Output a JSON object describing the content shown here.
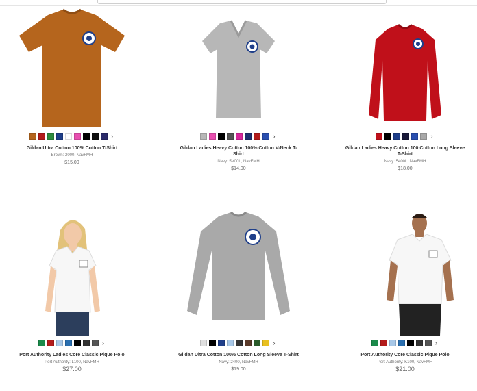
{
  "products": [
    {
      "title": "Gildan Ultra Cotton 100% Cotton T-Shirt",
      "sku": "Brown: 2000, NavFMH",
      "price": "$15.00",
      "image": "orange-tshirt",
      "colors": [
        "#b5651d",
        "#b31b1b",
        "#2e8b3e",
        "#1f3f8a",
        "#ffffff",
        "#e84fb0",
        "#000000",
        "#101010",
        "#2a2a6a"
      ]
    },
    {
      "title": "Gildan Ladies Heavy Cotton 100% Cotton V-Neck T-Shirt",
      "sku": "Navy: 5V00L, NavFMH",
      "price": "$14.00",
      "image": "grey-vneck",
      "colors": [
        "#b8b8b8",
        "#e84fb0",
        "#000000",
        "#555555",
        "#d8269c",
        "#1e2f6e",
        "#b31b1b",
        "#2a4fb0"
      ]
    },
    {
      "title": "Gildan Ladies Heavy Cotton 100 Cotton Long Sleeve T-Shirt",
      "sku": "Navy: 5400L, NavFMH",
      "price": "$18.00",
      "image": "red-longsleeve",
      "colors": [
        "#c0101a",
        "#000000",
        "#1f3f8a",
        "#1a1a3a",
        "#2a4fb0",
        "#a8a8a8"
      ]
    },
    {
      "title": "Port Authority Ladies Core Classic Pique Polo",
      "sku": "Port Authority: L100, NavFMH",
      "price": "$27.00",
      "image": "woman-white-polo",
      "colors": [
        "#1a8a4a",
        "#b31b1b",
        "#a8c8e8",
        "#2a6fb0",
        "#000000",
        "#333333",
        "#555555"
      ]
    },
    {
      "title": "Gildan Ultra Cotton 100% Cotton Long Sleeve T-Shirt",
      "sku": "Navy: 2400, NavFMH",
      "price": "$19.00",
      "image": "grey-longsleeve",
      "colors": [
        "#e0e0e0",
        "#000000",
        "#1f3f8a",
        "#a8c8e8",
        "#333333",
        "#5a3a2a",
        "#2a5a2a",
        "#e8c020"
      ]
    },
    {
      "title": "Port Authority Core Classic Pique Polo",
      "sku": "Port Authority: K100, NavFMH",
      "price": "$21.00",
      "image": "man-white-polo",
      "colors": [
        "#1a8a4a",
        "#b31b1b",
        "#a8c8e8",
        "#2a6fb0",
        "#000000",
        "#333333",
        "#555555"
      ]
    }
  ]
}
